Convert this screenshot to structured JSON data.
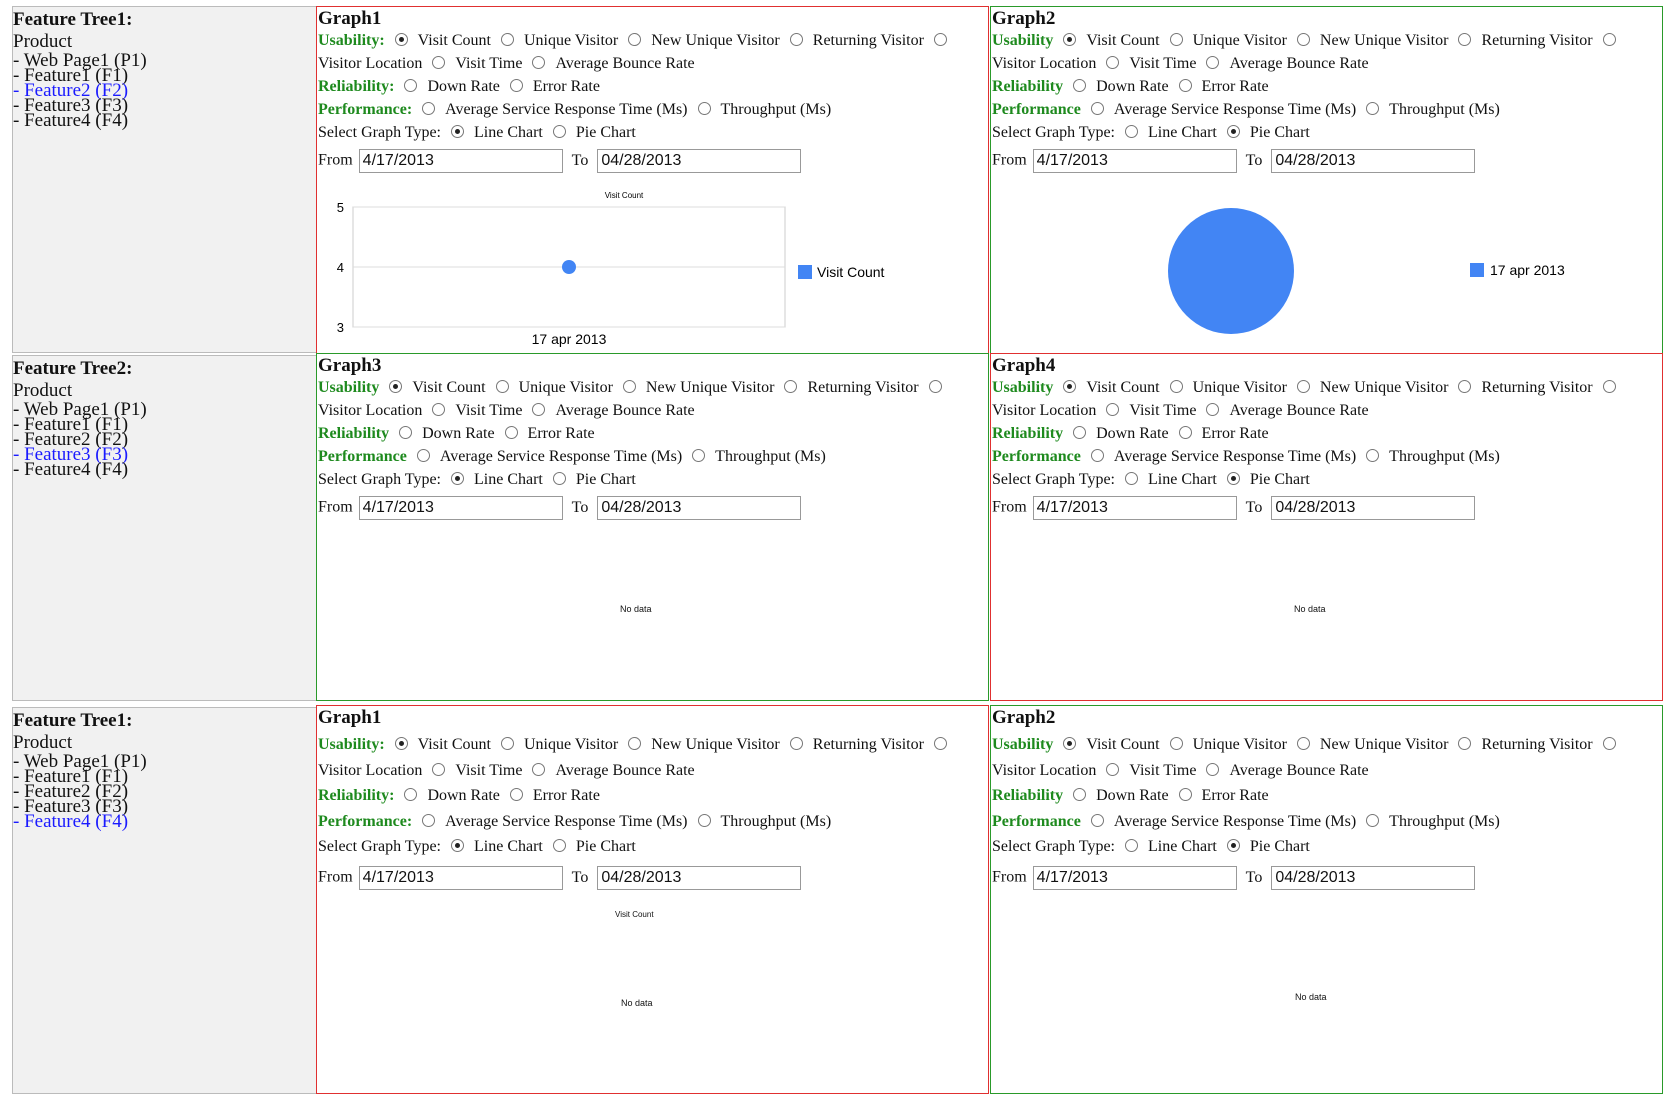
{
  "trees": [
    {
      "title": "Feature Tree1:",
      "root": "Product",
      "items": [
        "- Web Page1 (P1)",
        "- Feature1 (F1)",
        "- Feature2 (F2)",
        "- Feature3 (F3)",
        "- Feature4 (F4)"
      ],
      "selected": 2
    },
    {
      "title": "Feature Tree2:",
      "root": "Product",
      "items": [
        "- Web Page1 (P1)",
        "- Feature1 (F1)",
        "- Feature2 (F2)",
        "- Feature3 (F3)",
        "- Feature4 (F4)"
      ],
      "selected": 3
    },
    {
      "title": "Feature Tree1:",
      "root": "Product",
      "items": [
        "- Web Page1 (P1)",
        "- Feature1 (F1)",
        "- Feature2 (F2)",
        "- Feature3 (F3)",
        "- Feature4 (F4)"
      ],
      "selected": 4
    }
  ],
  "labels": {
    "usability_colon": "Usability:",
    "usability": "Usability",
    "reliability_colon": "Reliability:",
    "reliability": "Reliability",
    "performance_colon": "Performance:",
    "performance": "Performance",
    "visit_count": "Visit Count",
    "unique_visitor": "Unique Visitor",
    "new_unique_visitor": "New Unique Visitor",
    "returning_visitor": "Returning Visitor",
    "visitor_location": "Visitor Location",
    "visit_time": "Visit Time",
    "average_bounce_rate": "Average Bounce Rate",
    "down_rate": "Down Rate",
    "error_rate": "Error Rate",
    "avg_service_response_time": "Average Service Response Time (Ms)",
    "throughput": "Throughput (Ms)",
    "select_graph_type": "Select Graph Type:",
    "line_chart": "Line Chart",
    "pie_chart": "Pie Chart",
    "from": "From",
    "to": "To",
    "no_data": "No data"
  },
  "panels": [
    {
      "title": "Graph1",
      "from": "4/17/2013",
      "to": "04/28/2013",
      "graph_type": "line",
      "chart_title": "Visit Count"
    },
    {
      "title": "Graph2",
      "from": "4/17/2013",
      "to": "04/28/2013",
      "graph_type": "pie"
    },
    {
      "title": "Graph3",
      "from": "4/17/2013",
      "to": "04/28/2013",
      "graph_type": "line"
    },
    {
      "title": "Graph4",
      "from": "4/17/2013",
      "to": "04/28/2013",
      "graph_type": "pie"
    },
    {
      "title": "Graph1",
      "from": "4/17/2013",
      "to": "04/28/2013",
      "graph_type": "line",
      "chart_title": "Visit Count"
    },
    {
      "title": "Graph2",
      "from": "4/17/2013",
      "to": "04/28/2013",
      "graph_type": "pie"
    }
  ],
  "colors": {
    "accent_green": "#1e8a1e",
    "series_blue": "#4285f4",
    "link_blue": "#1a1aff",
    "border_red": "#e03030",
    "border_green": "#2a9a2a"
  },
  "chart_data": [
    {
      "type": "line",
      "title": "Visit Count",
      "x": [
        "17 apr 2013"
      ],
      "series": [
        {
          "name": "Visit Count",
          "values": [
            4
          ]
        }
      ],
      "ylim": [
        3,
        5
      ],
      "yticks": [
        3,
        4,
        5
      ],
      "legend": "right"
    },
    {
      "type": "pie",
      "categories": [
        "17 apr 2013"
      ],
      "values": [
        4
      ],
      "legend": "right"
    }
  ]
}
